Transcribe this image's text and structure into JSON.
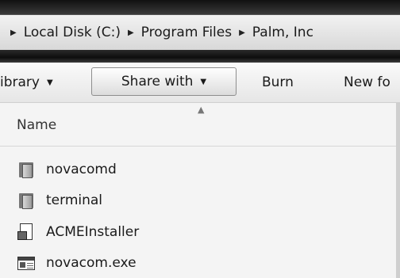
{
  "breadcrumb": {
    "items": [
      "Local Disk (C:)",
      "Program Files",
      "Palm, Inc"
    ],
    "separator": "▶"
  },
  "toolbar": {
    "library_label": "ibrary",
    "share_with_label": "Share with",
    "burn_label": "Burn",
    "new_folder_label": "New fo",
    "dropdown_arrow": "▼"
  },
  "file_list": {
    "column_name": "Name",
    "sort_indicator": "▲",
    "items": [
      {
        "name": "novacomd",
        "icon": "folder-icon"
      },
      {
        "name": "terminal",
        "icon": "folder-icon"
      },
      {
        "name": "ACMEInstaller",
        "icon": "installer-file-icon"
      },
      {
        "name": "novacom.exe",
        "icon": "executable-icon"
      }
    ]
  }
}
